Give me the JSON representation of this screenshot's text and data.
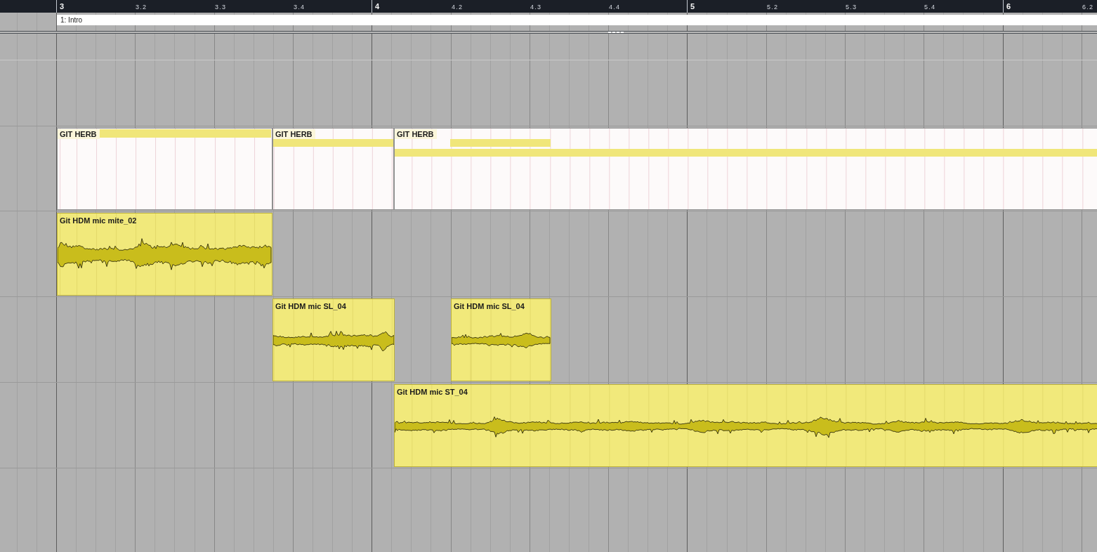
{
  "ruler": {
    "labels": [
      {
        "text": "3",
        "kind": "bar"
      },
      {
        "text": "3.2",
        "kind": "beat"
      },
      {
        "text": "3.3",
        "kind": "beat"
      },
      {
        "text": "3.4",
        "kind": "beat"
      },
      {
        "text": "4",
        "kind": "bar"
      },
      {
        "text": "4.2",
        "kind": "beat"
      },
      {
        "text": "4.3",
        "kind": "beat"
      },
      {
        "text": "4.4",
        "kind": "beat"
      },
      {
        "text": "5",
        "kind": "bar"
      },
      {
        "text": "5.2",
        "kind": "beat"
      },
      {
        "text": "5.3",
        "kind": "beat"
      },
      {
        "text": "5.4",
        "kind": "beat"
      },
      {
        "text": "6",
        "kind": "bar"
      },
      {
        "text": "6.2",
        "kind": "beat"
      }
    ]
  },
  "marker_track": {
    "markers": [
      {
        "text": "1: Intro"
      }
    ]
  },
  "tracks": [
    {
      "kind": "midi",
      "parts": [
        {
          "name": "GIT HERB"
        },
        {
          "name": "GIT HERB"
        },
        {
          "name": "GIT HERB"
        }
      ]
    },
    {
      "kind": "audio",
      "parts": [
        {
          "name": "Git HDM mic mite_02"
        }
      ]
    },
    {
      "kind": "audio",
      "parts": [
        {
          "name": "Git HDM mic SL_04"
        },
        {
          "name": "Git HDM mic SL_04"
        }
      ]
    },
    {
      "kind": "audio",
      "parts": [
        {
          "name": "Git HDM mic ST_04"
        }
      ]
    }
  ]
}
